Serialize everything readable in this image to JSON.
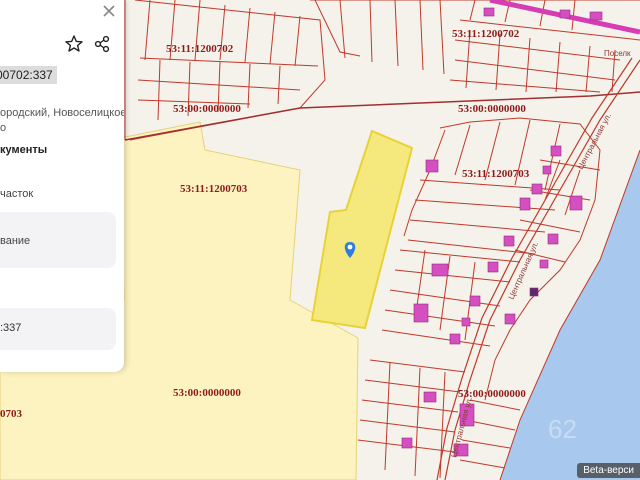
{
  "panel": {
    "cadastral_number": "00702:337",
    "address_line1": "ородский, Новоселицкое",
    "address_line2": "о",
    "documents_label": "кументы",
    "land_type": "часток",
    "purpose_label": "вание",
    "number_value": ":337",
    "icons": [
      "close-icon",
      "star-icon",
      "share-icon"
    ]
  },
  "map": {
    "labels": {
      "q_1200702_left": "53:11:1200702",
      "q_1200702_right": "53:11:1200702",
      "q_0000000_top_left": "53:00:0000000",
      "q_0000000_top_right": "53:00:0000000",
      "q_1200703_left": "53:11:1200703",
      "q_1200703_right": "53:11:1200703",
      "q_0000000_bottom": "53:00:0000000",
      "q_0000000_river": "53:00:0000000",
      "q_0703_edge": "0703"
    },
    "streets": [
      "Центральная ул.",
      "Центральная ул.",
      "Центральная ул."
    ],
    "top_right_fragment": "Поселк",
    "watermark": "62",
    "beta_label": "Beta-верси",
    "colors": {
      "parcel_border": "#c0392b",
      "selected_fill": "#f5e97e",
      "area_fill": "#fdf3c1",
      "building": "#d64fc0",
      "river": "#a9c8ee",
      "marker": "#2e7de0"
    }
  }
}
